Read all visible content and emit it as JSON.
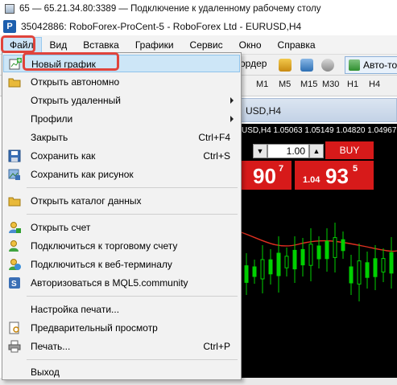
{
  "rdp": {
    "title": "65 — 65.21.34.80:3389 — Подключение к удаленному рабочему столу"
  },
  "app": {
    "title": "35042886: RoboForex-ProCent-5 - RoboForex Ltd - EURUSD,H4"
  },
  "menubar": {
    "items": [
      "Файл",
      "Вид",
      "Вставка",
      "Графики",
      "Сервис",
      "Окно",
      "Справка"
    ]
  },
  "toolbar": {
    "order_label": "ордер",
    "autotrade_label": "Авто-то"
  },
  "timeframes": [
    "M1",
    "M5",
    "M15",
    "M30",
    "H1",
    "H4"
  ],
  "chart": {
    "tab_label": "USD,H4",
    "info": "USD,H4  1.05063 1.05149 1.04820 1.04967",
    "qty": "1.00",
    "buy_label": "BUY",
    "sell_big": "90",
    "sell_sup": "7",
    "buy_small": "1.04",
    "buy_big": "93",
    "buy_sup": "5",
    "colors": {
      "quote_bg": "#d71a1a",
      "candle": "#00d000",
      "ma": "#e03020"
    }
  },
  "dropdown": {
    "items": [
      {
        "label": "Новый график",
        "icon": "new-chart-icon",
        "shortcut": ""
      },
      {
        "label": "Открыть автономно",
        "icon": "folder-icon",
        "shortcut": ""
      },
      {
        "label": "Открыть удаленный",
        "icon": "",
        "shortcut": "",
        "submenu": true
      },
      {
        "label": "Профили",
        "icon": "",
        "shortcut": "",
        "submenu": true
      },
      {
        "label": "Закрыть",
        "icon": "",
        "shortcut": "Ctrl+F4"
      },
      {
        "label": "Сохранить как",
        "icon": "save-icon",
        "shortcut": "Ctrl+S"
      },
      {
        "label": "Сохранить как рисунок",
        "icon": "save-picture-icon",
        "shortcut": ""
      },
      {
        "label": "Открыть каталог данных",
        "icon": "folder-icon",
        "shortcut": ""
      },
      {
        "label": "Открыть счет",
        "icon": "add-user-icon",
        "shortcut": ""
      },
      {
        "label": "Подключиться к торговому счету",
        "icon": "connect-account-icon",
        "shortcut": ""
      },
      {
        "label": "Подключиться к веб-терминалу",
        "icon": "web-terminal-icon",
        "shortcut": ""
      },
      {
        "label": "Авторизоваться в MQL5.community",
        "icon": "mql5-icon",
        "shortcut": ""
      },
      {
        "label": "Настройка печати...",
        "icon": "",
        "shortcut": ""
      },
      {
        "label": "Предварительный просмотр",
        "icon": "print-preview-icon",
        "shortcut": ""
      },
      {
        "label": "Печать...",
        "icon": "printer-icon",
        "shortcut": "Ctrl+P"
      },
      {
        "label": "Выход",
        "icon": "",
        "shortcut": ""
      }
    ]
  },
  "highlight_color": "#e0443c"
}
